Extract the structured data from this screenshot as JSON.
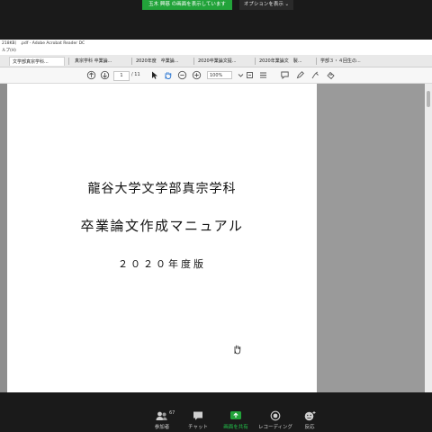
{
  "zoom": {
    "share_banner": "玉木 興慈 の画面を表示しています",
    "view_options": "オプションを表示 ⌄",
    "controls": [
      {
        "label": "参加者",
        "count": "67"
      },
      {
        "label": "チャット"
      },
      {
        "label": "画面を共有"
      },
      {
        "label": "レコーディング"
      },
      {
        "label": "反応"
      }
    ],
    "colors": {
      "share_green": "#22a33a",
      "bar_bg": "#1a1a1a"
    }
  },
  "acrobat": {
    "title": "218KB） .pdf - Adobe Acrobat Reader DC",
    "menu": "ルプ(H)",
    "tabs": [
      "文学部真宗学科...",
      "真宗学科 卒業論...",
      "2020年度　卒業論...",
      "2020卒業論文提...",
      "2020年業論文　製...",
      "学部３・４回生の..."
    ],
    "toolbar": {
      "page_current": "1",
      "page_total": "/ 11",
      "zoom": "100%"
    }
  },
  "document": {
    "dept": "龍谷大学文学部真宗学科",
    "title": "卒業論文作成マニュアル",
    "edition": "２０２０年度版"
  }
}
